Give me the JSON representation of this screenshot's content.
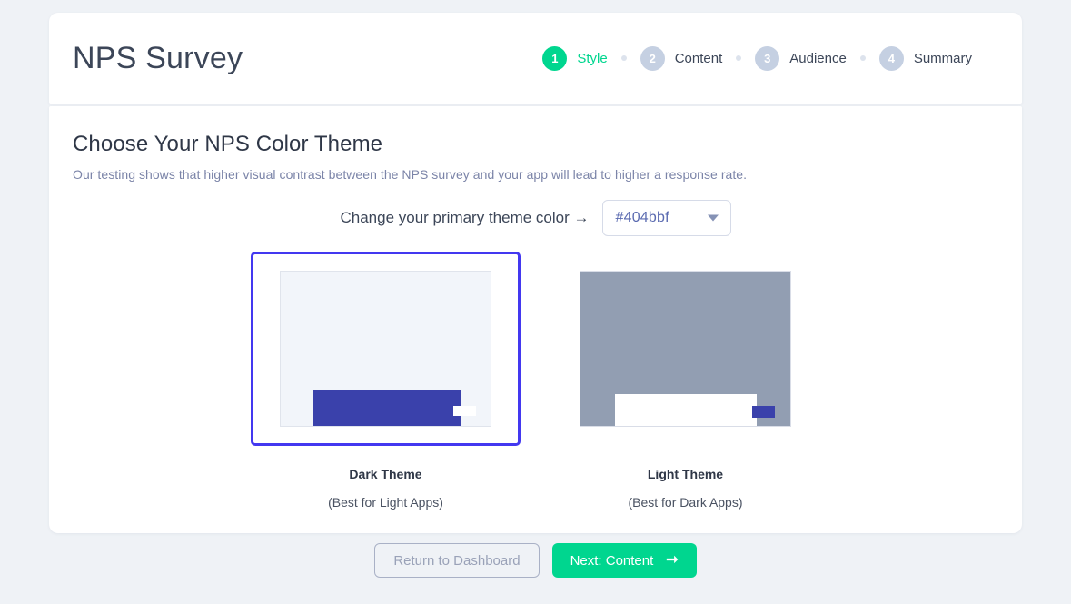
{
  "header": {
    "title": "NPS Survey",
    "steps": [
      {
        "number": "1",
        "label": "Style",
        "state": "active"
      },
      {
        "number": "2",
        "label": "Content",
        "state": "inactive"
      },
      {
        "number": "3",
        "label": "Audience",
        "state": "inactive"
      },
      {
        "number": "4",
        "label": "Summary",
        "state": "inactive"
      }
    ]
  },
  "main": {
    "section_title": "Choose Your NPS Color Theme",
    "section_subtitle": "Our testing shows that higher visual contrast between the NPS survey and your app will lead to higher a response rate.",
    "picker": {
      "caption": "Change your primary theme color →",
      "selected_color": "#404bbf",
      "caret_icon": "chevron-down-icon"
    },
    "themes": [
      {
        "name": "Dark Theme",
        "hint": "(Best for Light Apps)",
        "selected": true
      },
      {
        "name": "Light Theme",
        "hint": "(Best for Dark Apps)",
        "selected": false
      }
    ]
  },
  "footer": {
    "back_label": "Return to Dashboard",
    "next_label": "Next: Content",
    "next_icon": "arrow-right-icon"
  },
  "colors": {
    "accent_green": "#00d68f",
    "theme_blue": "#404bbf",
    "selected_border": "#4338f0",
    "page_background": "#eff2f6",
    "step_inactive": "#c5d0e2"
  }
}
